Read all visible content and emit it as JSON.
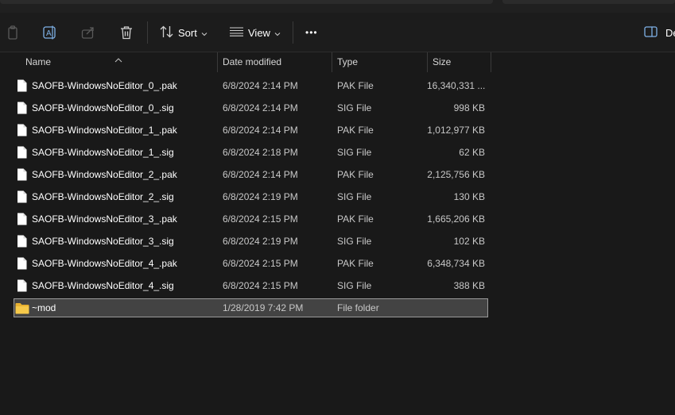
{
  "toolbar": {
    "sort_label": "Sort",
    "view_label": "View",
    "more_label": "•••",
    "details_label": "Details"
  },
  "columns": {
    "name": "Name",
    "date": "Date modified",
    "type": "Type",
    "size": "Size"
  },
  "files": [
    {
      "name": "SAOFB-WindowsNoEditor_0_.pak",
      "date": "6/8/2024 2:14 PM",
      "type": "PAK File",
      "size": "16,340,331 ...",
      "icon": "file-icon"
    },
    {
      "name": "SAOFB-WindowsNoEditor_0_.sig",
      "date": "6/8/2024 2:14 PM",
      "type": "SIG File",
      "size": "998 KB",
      "icon": "file-icon"
    },
    {
      "name": "SAOFB-WindowsNoEditor_1_.pak",
      "date": "6/8/2024 2:14 PM",
      "type": "PAK File",
      "size": "1,012,977 KB",
      "icon": "file-icon"
    },
    {
      "name": "SAOFB-WindowsNoEditor_1_.sig",
      "date": "6/8/2024 2:18 PM",
      "type": "SIG File",
      "size": "62 KB",
      "icon": "file-icon"
    },
    {
      "name": "SAOFB-WindowsNoEditor_2_.pak",
      "date": "6/8/2024 2:14 PM",
      "type": "PAK File",
      "size": "2,125,756 KB",
      "icon": "file-icon"
    },
    {
      "name": "SAOFB-WindowsNoEditor_2_.sig",
      "date": "6/8/2024 2:19 PM",
      "type": "SIG File",
      "size": "130 KB",
      "icon": "file-icon"
    },
    {
      "name": "SAOFB-WindowsNoEditor_3_.pak",
      "date": "6/8/2024 2:15 PM",
      "type": "PAK File",
      "size": "1,665,206 KB",
      "icon": "file-icon"
    },
    {
      "name": "SAOFB-WindowsNoEditor_3_.sig",
      "date": "6/8/2024 2:19 PM",
      "type": "SIG File",
      "size": "102 KB",
      "icon": "file-icon"
    },
    {
      "name": "SAOFB-WindowsNoEditor_4_.pak",
      "date": "6/8/2024 2:15 PM",
      "type": "PAK File",
      "size": "6,348,734 KB",
      "icon": "file-icon"
    },
    {
      "name": "SAOFB-WindowsNoEditor_4_.sig",
      "date": "6/8/2024 2:15 PM",
      "type": "SIG File",
      "size": "388 KB",
      "icon": "file-icon"
    },
    {
      "name": "~mod",
      "date": "1/28/2019 7:42 PM",
      "type": "File folder",
      "size": "",
      "icon": "folder-icon",
      "selected": true
    }
  ],
  "colors": {
    "background": "#191919",
    "selection": "#434343",
    "folder": "#f3c23c"
  }
}
